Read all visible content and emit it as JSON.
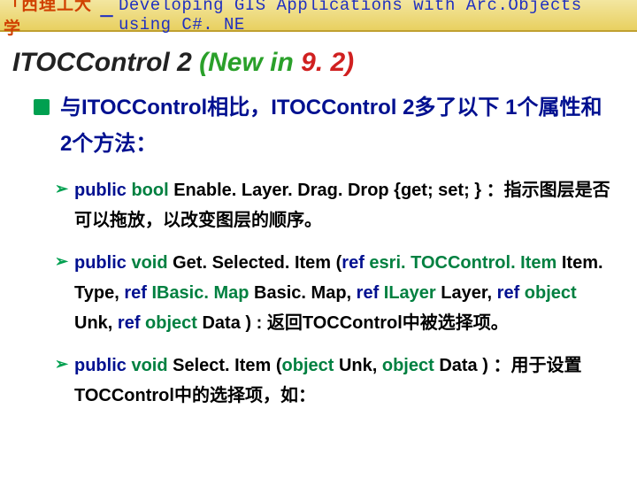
{
  "header": {
    "university": "「西理工大学",
    "dash": "－",
    "course": "Developing GIS Applications with Arc.Objects using C#. NE"
  },
  "title": {
    "part1": "ITOCControl 2 ",
    "part2": "(New  in  ",
    "part3": "9. 2)"
  },
  "bullet": {
    "text": "与ITOCControl相比，ITOCControl 2多了以下 1个属性和2个方法："
  },
  "subs": [
    {
      "pre": "public ",
      "t1": "bool ",
      "m1": "Enable. Layer. Drag. Drop {get; set; }",
      "rest": " ：指示图层是否可以拖放，以改变图层的顺序。"
    },
    {
      "pre": "public ",
      "t1": "void ",
      "m1": "Get. Selected. Item (",
      "kw1": "ref ",
      "t2": "esri. TOCControl. Item ",
      "l2": "Item. Type,  ",
      "kw2": "ref ",
      "t3": "IBasic. Map ",
      "l3": "Basic. Map, ",
      "kw3": "ref ",
      "t4": "ILayer ",
      "l4": "Layer, ",
      "kw4": "ref ",
      "t5": "object ",
      "l5": "Unk, ",
      "kw5": "ref ",
      "t6": "object ",
      "l6": "Data )",
      "rest": " : 返回TOCControl中被选择项。"
    },
    {
      "pre": "public ",
      "t1": "void ",
      "m1": "Select. Item (",
      "t2": "object ",
      "l2": "Unk,  ",
      "t3": "object ",
      "l3": "Data ) ",
      "rest": "：用于设置TOCControl中的选择项，如："
    }
  ]
}
